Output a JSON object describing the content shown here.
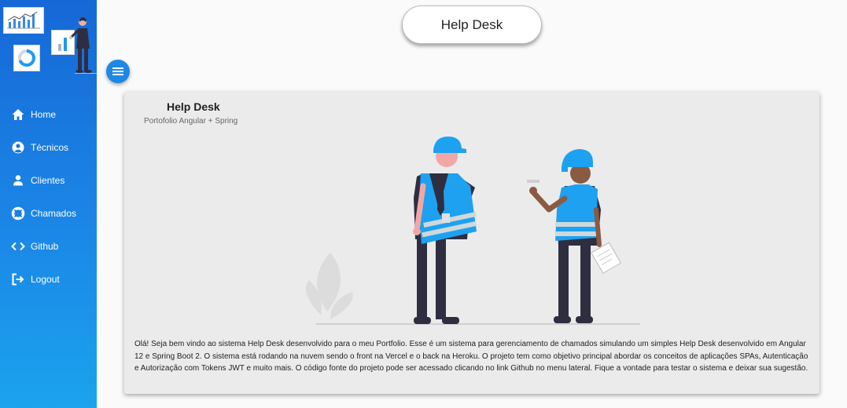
{
  "header": {
    "title": "Help Desk"
  },
  "sidebar": {
    "items": [
      {
        "label": "Home",
        "icon": "home-icon"
      },
      {
        "label": "Técnicos",
        "icon": "user-circle-icon"
      },
      {
        "label": "Clientes",
        "icon": "user-icon"
      },
      {
        "label": "Chamados",
        "icon": "life-ring-icon"
      },
      {
        "label": "Github",
        "icon": "code-icon"
      },
      {
        "label": "Logout",
        "icon": "logout-icon"
      }
    ]
  },
  "card": {
    "title": "Help Desk",
    "subtitle": "Portofolio Angular + Spring",
    "text": "Olá! Seja bem vindo ao sistema Help Desk desenvolvido para o meu Portfolio. Esse é um sistema para gerenciamento de chamados simulando um simples Help Desk desenvolvido em Angular 12 e Spring Boot 2. O sistema está rodando na nuvem sendo o front na Vercel e o back na Heroku. O projeto tem como objetivo principal abordar os conceitos de aplicações SPAs, Autenticação e Autorização com Tokens JWT e muito mais. O código fonte do projeto pode ser acessado clicando no link Github no menu lateral. Fique a vontade para testar o sistema e deixar sua sugestão."
  },
  "colors": {
    "sidebar_top": "#1668d6",
    "sidebar_bottom": "#1ba3ee",
    "accent": "#1e88e5",
    "helmet": "#1ea1f1"
  }
}
